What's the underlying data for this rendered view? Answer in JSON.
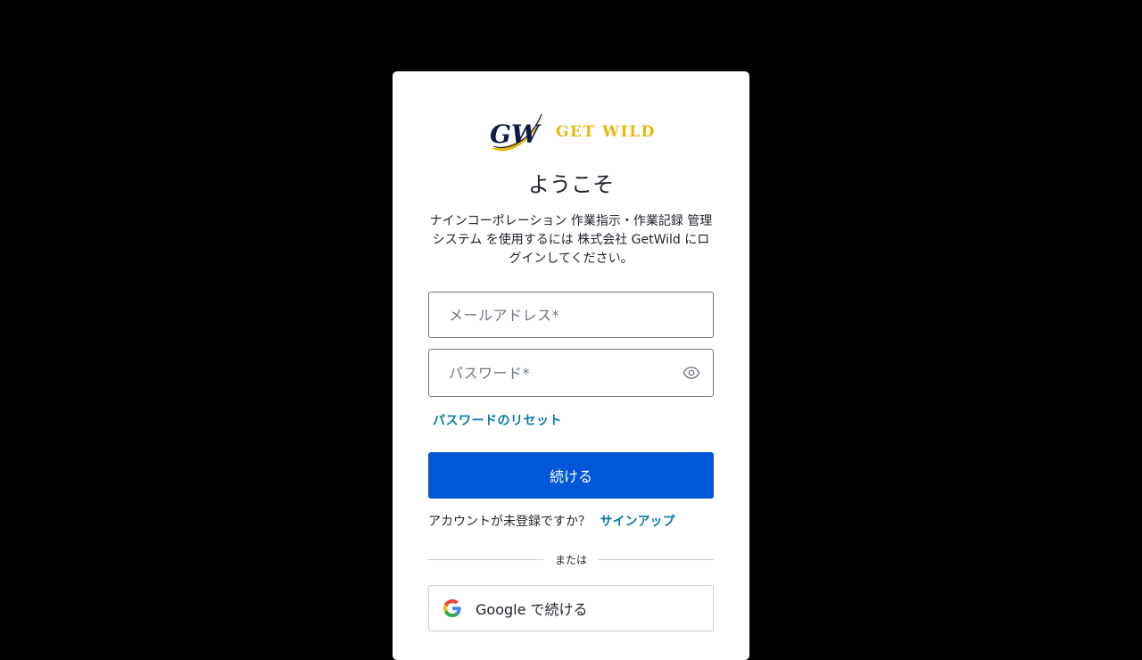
{
  "brand": {
    "monogram": "GW",
    "name": "GET WILD",
    "colors": {
      "navy": "#0e1a4a",
      "gold": "#e8b90c"
    }
  },
  "login": {
    "title": "ようこそ",
    "description": "ナインコーポレーション 作業指示・作業記録 管理システム を使用するには 株式会社 GetWild にログインしてください。",
    "email_placeholder": "メールアドレス*",
    "password_placeholder": "パスワード*",
    "show_password_icon": "eye-icon",
    "reset_link": "パスワードのリセット",
    "continue_label": "続ける",
    "no_account_text": "アカウントが未登録ですか？",
    "signup_link": "サインアップ",
    "or_text": "または",
    "google_label": "Google で続ける",
    "google_icon": "google-icon"
  },
  "colors": {
    "primary": "#0057d8",
    "link": "#0a7aa8",
    "text": "#1e212a",
    "background": "#000000"
  }
}
